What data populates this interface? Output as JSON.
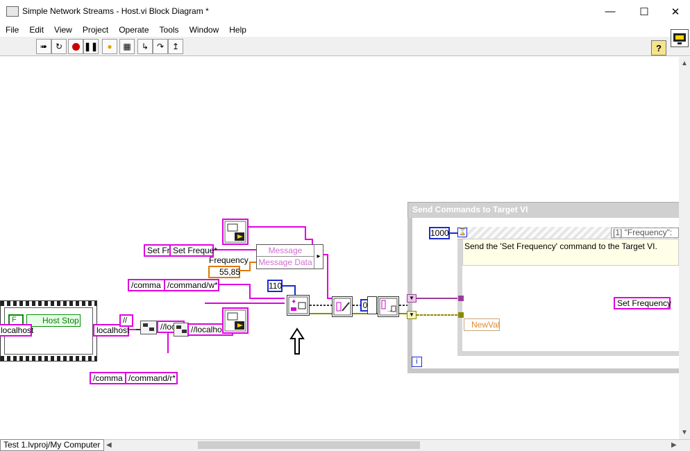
{
  "window": {
    "title": "Simple Network Streams - Host.vi Block Diagram *"
  },
  "menu": [
    "File",
    "Edit",
    "View",
    "Project",
    "Operate",
    "Tools",
    "Window",
    "Help"
  ],
  "toolbar": {
    "help_label": "?"
  },
  "diagram": {
    "set_freq_const_a": "Set Fre",
    "set_freq_const_b": "Set Freque*",
    "frequency_label": "Frequency",
    "frequency_value": "55,85",
    "bundle_field_1": "Message",
    "bundle_field_2": "Message Data",
    "command_w_a": "/comma",
    "command_w_b": "/command/w*",
    "num_const": "110",
    "num_const_small": "0",
    "localhost_a": "localhost",
    "localhost_b": "localhost",
    "slash_const": "//",
    "loc_a": "//loc",
    "loc_b": "//localhos*",
    "host_stop": "Host Stop",
    "f_const": "F",
    "command_r_a": "/comma",
    "command_r_b": "/command/r*",
    "wait_const": "1000",
    "loop_title": "Send Commands to Target VI",
    "case_selector": "[1] \"Frequency\":",
    "case_comment": "Send the 'Set Frequency' command to the Target VI.",
    "set_frequency_const": "Set Frequency",
    "newval_label": "NewVal",
    "iteration_label": "i"
  },
  "status": {
    "path": "Test 1.lvproj/My Computer"
  }
}
